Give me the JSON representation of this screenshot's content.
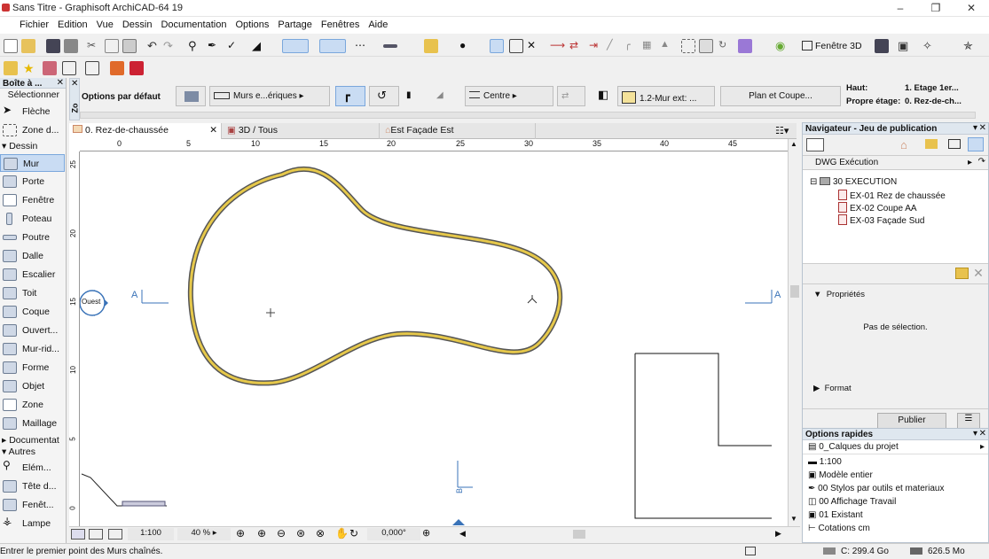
{
  "window": {
    "title": "Sans Titre - Graphisoft ArchiCAD-64 19"
  },
  "menu": [
    "Fichier",
    "Edition",
    "Vue",
    "Dessin",
    "Documentation",
    "Options",
    "Partage",
    "Fenêtres",
    "Aide"
  ],
  "toolbar": {
    "fenetre3d_label": "Fenêtre 3D"
  },
  "toolbox": {
    "title": "Boîte à ...",
    "select_label": "Sélectionner",
    "section_dessin": "Dessin",
    "section_documentation": "Documentat",
    "section_autres": "Autres",
    "tools": [
      {
        "name": "fleche",
        "label": "Flèche"
      },
      {
        "name": "zone-d",
        "label": "Zone d..."
      },
      {
        "name": "mur",
        "label": "Mur"
      },
      {
        "name": "porte",
        "label": "Porte"
      },
      {
        "name": "fenetre",
        "label": "Fenêtre"
      },
      {
        "name": "poteau",
        "label": "Poteau"
      },
      {
        "name": "poutre",
        "label": "Poutre"
      },
      {
        "name": "dalle",
        "label": "Dalle"
      },
      {
        "name": "escalier",
        "label": "Escalier"
      },
      {
        "name": "toit",
        "label": "Toit"
      },
      {
        "name": "coque",
        "label": "Coque"
      },
      {
        "name": "ouvert",
        "label": "Ouvert..."
      },
      {
        "name": "mur-rid",
        "label": "Mur-rid..."
      },
      {
        "name": "forme",
        "label": "Forme"
      },
      {
        "name": "objet",
        "label": "Objet"
      },
      {
        "name": "zone",
        "label": "Zone"
      },
      {
        "name": "maillage",
        "label": "Maillage"
      },
      {
        "name": "element",
        "label": "Elém..."
      },
      {
        "name": "tete",
        "label": "Tête d..."
      },
      {
        "name": "fenet",
        "label": "Fenêt..."
      },
      {
        "name": "lampe",
        "label": "Lampe"
      }
    ]
  },
  "infobox": {
    "default_options": "Options par défaut",
    "composite": "Murs e...ériques",
    "ref_line": "Centre",
    "layer": "1.2-Mur ext: ...",
    "plan_coupe": "Plan et Coupe...",
    "haut_label": "Haut:",
    "haut_value": "1. Etage 1er...",
    "propre_label": "Propre étage:",
    "propre_value": "0. Rez-de-ch...",
    "side_tab": "Zo"
  },
  "tabs": [
    {
      "label": "0. Rez-de-chaussée",
      "active": true
    },
    {
      "label": "3D / Tous",
      "active": false
    },
    {
      "label": "Est Façade Est",
      "active": false
    }
  ],
  "ruler": {
    "h_ticks": [
      "0",
      "5",
      "10",
      "15",
      "20",
      "25",
      "30",
      "35",
      "40",
      "45"
    ],
    "v_ticks": [
      "25",
      "20",
      "15",
      "10",
      "5",
      "0"
    ]
  },
  "canvas": {
    "marker_west": "Ouest",
    "marker_a_left": "A",
    "marker_a_right": "A",
    "marker_b": "B"
  },
  "view_status": {
    "scale": "1:100",
    "zoom": "40 %",
    "angle": "0,000°"
  },
  "navigator": {
    "title": "Navigateur - Jeu de publication",
    "set_name": "DWG Exécution",
    "folder": "30 EXECUTION",
    "items": [
      "EX-01 Rez de chaussée",
      "EX-02 Coupe AA",
      "EX-03 Façade Sud"
    ],
    "properties_label": "Propriétés",
    "no_selection": "Pas de sélection.",
    "format_label": "Format",
    "publish_button": "Publier"
  },
  "quick_options": {
    "title": "Options rapides",
    "layers": "0_Calques du projet",
    "items": [
      "1:100",
      "Modèle entier",
      "00 Stylos par outils et materiaux",
      "00 Affichage Travail",
      "01 Existant",
      "Cotations cm"
    ]
  },
  "status": {
    "message": "Entrer le premier point des Murs chaînés.",
    "disk": "C: 299.4 Go",
    "memory": "626.5 Mo"
  },
  "colors": {
    "accent": "#3a73b8",
    "wall_fill": "#e6c84a",
    "panel_header": "#dfe7ef"
  }
}
